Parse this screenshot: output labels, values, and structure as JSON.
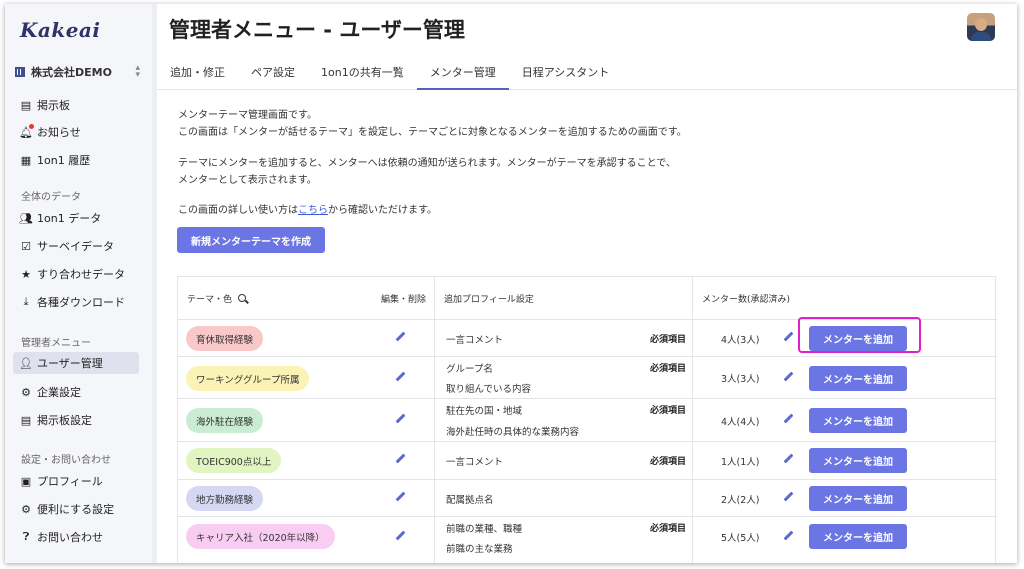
{
  "app": {
    "logo": "Kakeai",
    "company": "株式会社DEMO"
  },
  "sidebar": {
    "items_top": [
      {
        "label": "掲示板",
        "icon": "board-icon"
      },
      {
        "label": "お知らせ",
        "icon": "bell-icon"
      },
      {
        "label": "1on1 履歴",
        "icon": "history-icon"
      }
    ],
    "section_data": "全体のデータ",
    "items_data": [
      {
        "label": "1on1 データ",
        "icon": "people-icon"
      },
      {
        "label": "サーベイデータ",
        "icon": "survey-icon"
      },
      {
        "label": "すり合わせデータ",
        "icon": "pin-icon"
      },
      {
        "label": "各種ダウンロード",
        "icon": "download-icon"
      }
    ],
    "section_admin": "管理者メニュー",
    "items_admin": [
      {
        "label": "ユーザー管理",
        "icon": "user-manage-icon"
      },
      {
        "label": "企業設定",
        "icon": "company-settings-icon"
      },
      {
        "label": "掲示板設定",
        "icon": "board-settings-icon"
      }
    ],
    "section_settings": "設定・お問い合わせ",
    "items_settings": [
      {
        "label": "プロフィール",
        "icon": "profile-icon"
      },
      {
        "label": "便利にする設定",
        "icon": "gear-icon"
      },
      {
        "label": "お問い合わせ",
        "icon": "help-icon"
      }
    ]
  },
  "header": {
    "title": "管理者メニュー - ユーザー管理"
  },
  "tabs": [
    {
      "label": "追加・修正"
    },
    {
      "label": "ペア設定"
    },
    {
      "label": "1on1の共有一覧"
    },
    {
      "label": "メンター管理"
    },
    {
      "label": "日程アシスタント"
    }
  ],
  "description": {
    "line1": "メンターテーマ管理画面です。",
    "line2": "この画面は「メンターが話せるテーマ」を設定し、テーマごとに対象となるメンターを追加するための画面です。",
    "line3": "テーマにメンターを追加すると、メンターへは依頼の通知が送られます。メンターがテーマを承認することで、",
    "line4": "メンターとして表示されます。",
    "line5_pre": "この画面の詳しい使い方は",
    "line5_link": "こちら",
    "line5_post": "から確認いただけます。"
  },
  "create_button": "新規メンターテーマを作成",
  "table": {
    "headers": {
      "theme": "テーマ・色",
      "edit": "編集・削除",
      "profile": "追加プロフィール設定",
      "mentors": "メンター数(承認済み)"
    },
    "required_label": "必須項目",
    "add_label": "メンターを追加",
    "rows": [
      {
        "theme": "育休取得経験",
        "color": "#f9c9c9",
        "profiles": [
          "一言コメント"
        ],
        "required": true,
        "count": "4人(3人)"
      },
      {
        "theme": "ワーキンググループ所属",
        "color": "#fbf3b5",
        "profiles": [
          "グループ名",
          "取り組んでいる内容"
        ],
        "required": true,
        "count": "3人(3人)"
      },
      {
        "theme": "海外駐在経験",
        "color": "#c9ecd2",
        "profiles": [
          "駐在先の国・地域",
          "海外赴任時の具体的な業務内容"
        ],
        "required": true,
        "count": "4人(4人)"
      },
      {
        "theme": "TOEIC900点以上",
        "color": "#e3f4c3",
        "profiles": [
          "一言コメント"
        ],
        "required": true,
        "count": "1人(1人)"
      },
      {
        "theme": "地方勤務経験",
        "color": "#d6d8f3",
        "profiles": [
          "配属拠点名"
        ],
        "required": false,
        "count": "2人(2人)"
      },
      {
        "theme": "キャリア入社（2020年以降）",
        "color": "#f9cdf1",
        "profiles": [
          "前職の業種、職種",
          "前職の主な業務"
        ],
        "required": true,
        "count": "5人(5人)"
      }
    ]
  },
  "colors": {
    "accent": "#6b76e4",
    "highlight": "#e020c8",
    "tab_underline": "#5562c4"
  }
}
